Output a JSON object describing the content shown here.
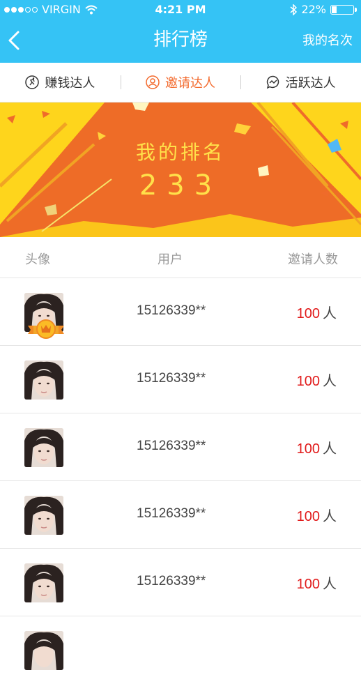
{
  "status_bar": {
    "carrier": "VIRGIN",
    "time": "4:21 PM",
    "battery": "22%",
    "battery_level": 0.22
  },
  "nav": {
    "title": "排行榜",
    "action": "我的名次"
  },
  "tabs": [
    {
      "label": "赚钱达人",
      "icon": "runner-icon",
      "active": false
    },
    {
      "label": "邀请达人",
      "icon": "user-circle-icon",
      "active": true
    },
    {
      "label": "活跃达人",
      "icon": "chat-bolt-icon",
      "active": false
    }
  ],
  "banner": {
    "label": "我的排名",
    "rank": "233"
  },
  "list_header": {
    "col_avatar": "头像",
    "col_user": "用户",
    "col_count": "邀请人数"
  },
  "rows": [
    {
      "phone": "15126339**",
      "count": "100",
      "unit": "人",
      "medal": true
    },
    {
      "phone": "15126339**",
      "count": "100",
      "unit": "人",
      "medal": false
    },
    {
      "phone": "15126339**",
      "count": "100",
      "unit": "人",
      "medal": false
    },
    {
      "phone": "15126339**",
      "count": "100",
      "unit": "人",
      "medal": false
    },
    {
      "phone": "15126339**",
      "count": "100",
      "unit": "人",
      "medal": false
    }
  ],
  "colors": {
    "header": "#35c3f5",
    "active_tab": "#f36a2d",
    "banner_yellow": "#fed51c",
    "banner_orange": "#ee6c27",
    "count_red": "#e11b1b"
  }
}
